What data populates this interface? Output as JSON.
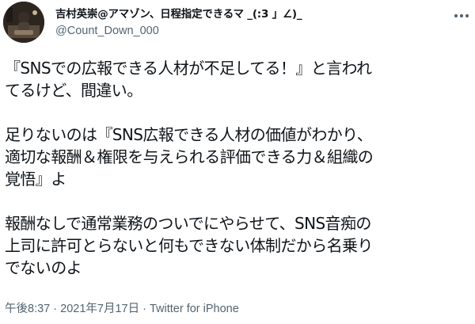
{
  "tweet": {
    "author": {
      "display_name": "吉村英崇@アマゾン、日程指定できるマ _(:3 」∠)_",
      "handle": "@Count_Down_000",
      "avatar_icon": "profile-photo"
    },
    "more_icon": "more-dots-icon",
    "text": {
      "p1_line1": "『SNSでの広報できる人材が不足してる！』と言われ",
      "p1_line2": "てるけど、間違い。",
      "p2_line1": "足りないのは『SNS広報できる人材の価値がわかり、",
      "p2_line2": "適切な報酬＆権限を与えられる評価できる力＆組織の",
      "p2_line3": "覚悟』よ",
      "p3_line1": "報酬なしで通常業務のついでにやらせて、SNS音痴の",
      "p3_line2": "上司に許可とらないと何もできない体制だから名乗り",
      "p3_line3": "でないのよ"
    },
    "meta": {
      "time": "午後8:37",
      "separator1": " · ",
      "date": "2021年7月17日",
      "separator2": " · ",
      "source": "Twitter for iPhone"
    },
    "colors": {
      "text": "#0f1419",
      "secondary": "#536471",
      "background": "#ffffff"
    }
  }
}
